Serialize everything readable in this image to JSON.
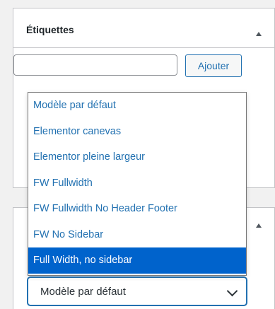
{
  "tags_panel": {
    "title": "Étiquettes",
    "input_value": "",
    "add_button_label": "Ajouter"
  },
  "template_select": {
    "selected_value": "Modèle par défaut",
    "options": [
      {
        "label": "Modèle par défaut",
        "selected": false
      },
      {
        "label": "Elementor canevas",
        "selected": false
      },
      {
        "label": "Elementor pleine largeur",
        "selected": false
      },
      {
        "label": "FW Fullwidth",
        "selected": false
      },
      {
        "label": "FW Fullwidth No Header Footer",
        "selected": false
      },
      {
        "label": "FW No Sidebar",
        "selected": false
      },
      {
        "label": "Full Width, no sidebar",
        "selected": true
      }
    ]
  },
  "colors": {
    "accent": "#2271b1",
    "highlight": "#0063cc",
    "border": "#c3c4c7"
  }
}
